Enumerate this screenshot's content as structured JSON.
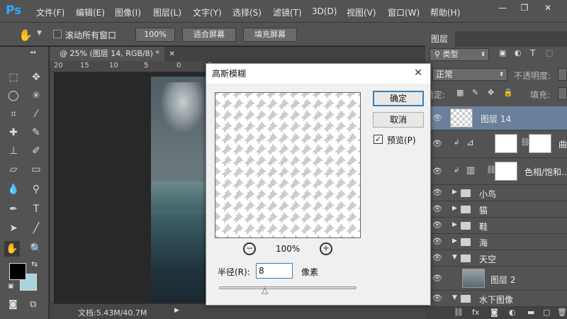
{
  "app": {
    "logo": "Ps"
  },
  "menu": [
    "文件(F)",
    "编辑(E)",
    "图像(I)",
    "图层(L)",
    "文字(Y)",
    "选择(S)",
    "滤镜(T)",
    "3D(D)",
    "视图(V)",
    "窗口(W)",
    "帮助(H)"
  ],
  "window_controls": {
    "minimize": "—",
    "restore": "❐",
    "close": "✕"
  },
  "options": {
    "scroll_all_label": "滚动所有窗口",
    "zoom_100": "100%",
    "fit_screen": "适合屏幕",
    "fill_screen": "填充屏幕"
  },
  "document": {
    "tab_title": "@ 25% (图层 14, RGB/8) *",
    "tab_close": "✕",
    "ruler_numbers": [
      "20",
      "15",
      "10",
      "5",
      "0",
      "5"
    ],
    "status": "文档:5.43M/40.7M"
  },
  "layers_panel": {
    "title": "图层",
    "filter_kind": "类型",
    "blend_mode": "正常",
    "opacity_label": "不透明度:",
    "lock_label": "锁定:",
    "fill_label": "填充:",
    "layers": [
      {
        "name": "图层 14",
        "type": "pixel",
        "selected": true
      },
      {
        "name": "曲",
        "type": "adjustment-curves"
      },
      {
        "name": "色相/饱和...",
        "type": "adjustment-hue"
      },
      {
        "name": "小鸟",
        "type": "group"
      },
      {
        "name": "猫",
        "type": "group"
      },
      {
        "name": "鞋",
        "type": "group"
      },
      {
        "name": "海",
        "type": "group"
      },
      {
        "name": "天空",
        "type": "group-open"
      },
      {
        "name": "图层 2",
        "type": "pixel"
      },
      {
        "name": "水下图像",
        "type": "group-open"
      }
    ]
  },
  "dialog": {
    "title": "高斯模糊",
    "ok": "确定",
    "cancel": "取消",
    "preview_label": "预览(P)",
    "preview_checked": true,
    "zoom": "100%",
    "radius_label": "半径(R):",
    "radius_value": "8",
    "unit": "像素"
  },
  "colors": {
    "foreground": "#000000",
    "background": "#a6d4dc",
    "accent": "#31a8ff"
  }
}
